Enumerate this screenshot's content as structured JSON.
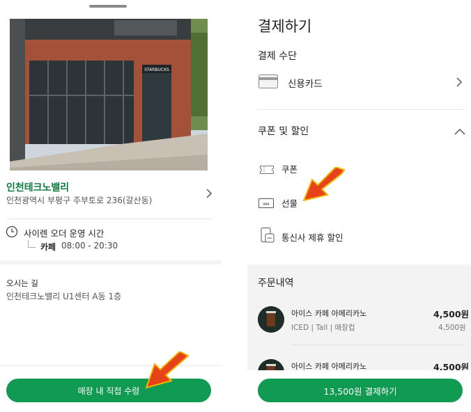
{
  "store": {
    "name": "인천테크노밸리",
    "address": "인천광역시 부평구 주부토로 236(갈산동)",
    "photo_sign": "STARBUCKS",
    "hours_title": "사이렌 오더 운영 시간",
    "hours_label": "카페",
    "hours_time": "08:00 - 20:30",
    "directions_title": "오시는 길",
    "directions_text": "인천테크노밸리 U1센터 A동 1층",
    "pickup_button": "매장 내 직접 수령"
  },
  "payment": {
    "title": "결제하기",
    "method_title": "결제 수단",
    "card_label": "신용카드",
    "coupon_section_title": "쿠폰 및 할인",
    "options": [
      {
        "label": "쿠폰",
        "icon": "coupon-icon"
      },
      {
        "label": "선물",
        "icon": "gift-card-icon"
      },
      {
        "label": "통신사 제휴 할인",
        "icon": "telecom-discount-icon"
      }
    ],
    "order_title": "주문내역",
    "items": [
      {
        "name": "아이스 카페 아메리카노",
        "price": "4,500원",
        "options": "ICED | Tall | 매장컵",
        "subtotal": "4,500원"
      },
      {
        "name": "아이스 카페 아메리카노",
        "price": "4,500원"
      }
    ],
    "pay_button": "13,500원 결제하기"
  },
  "colors": {
    "brand_green": "#119a52",
    "name_green": "#0c7a3e",
    "annotation_arrow": "#e8421a"
  }
}
